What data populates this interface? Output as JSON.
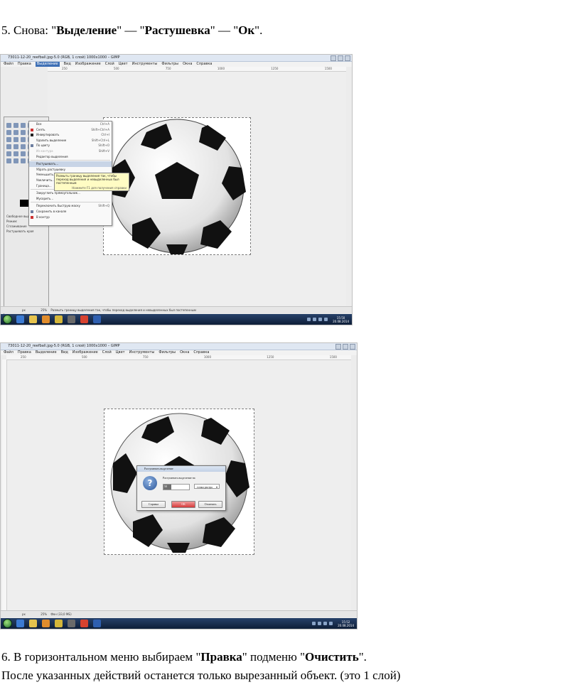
{
  "step5": {
    "prefix": "5. Снова: \"",
    "w1": "Выделение",
    "sep1": "\" — \"",
    "w2": "Растушевка",
    "sep2": "\" — \"",
    "w3": "Ок",
    "suffix": "\"."
  },
  "shot1": {
    "window_title": "73011-12-20_reefball.jpg-5.0 (RGB, 1 слой) 1000x1000 – GIMP",
    "menu": [
      "Файл",
      "Правка",
      "Выделение",
      "Вид",
      "Изображение",
      "Слой",
      "Цвет",
      "Инструменты",
      "Фильтры",
      "Окна",
      "Справка"
    ],
    "menu_active": "Выделение",
    "ruler_ticks": [
      "250",
      "500",
      "750",
      "1000",
      "1250",
      "1500"
    ],
    "selection_menu": [
      {
        "label": "Все",
        "shortcut": "Ctrl+A"
      },
      {
        "label": "Снять",
        "shortcut": "Shift+Ctrl+A"
      },
      {
        "label": "Инвертировать",
        "shortcut": "Ctrl+I"
      },
      {
        "label": "Удалить выделение",
        "shortcut": "Shift+Ctrl+L"
      },
      {
        "label": "По цвету",
        "shortcut": "Shift+O"
      },
      {
        "label": "Из контура",
        "shortcut": "Shift+V"
      },
      {
        "label": "Редактор выделения",
        "shortcut": ""
      },
      {
        "label": "Растушевать...",
        "shortcut": ""
      },
      {
        "label": "Убрать растушевку",
        "shortcut": ""
      },
      {
        "label": "Уменьшить...",
        "shortcut": ""
      },
      {
        "label": "Увеличить...",
        "shortcut": ""
      },
      {
        "label": "Граница...",
        "shortcut": ""
      },
      {
        "label": "Закруглить прямоугольник...",
        "shortcut": ""
      },
      {
        "label": "Мусорить...",
        "shortcut": ""
      },
      {
        "label": "Переключить быструю маску",
        "shortcut": "Shift+Q"
      },
      {
        "label": "Сохранить в канале",
        "shortcut": ""
      },
      {
        "label": "В контур",
        "shortcut": ""
      }
    ],
    "tooltip": "Размыть границу выделения так, чтобы переход выделения и невыделенных был постепенным",
    "tooltip_hint": "Нажмите F1 для получения справки",
    "toolbox_options": [
      "Свободное выделение",
      "Режим:",
      "Сглаживание",
      "Растушевать края"
    ],
    "status_zoom": "px",
    "status_percent": "25%",
    "status_text": "Размыть границу выделения так, чтобы переход выделения и невыделенных был постепенным",
    "clock_time": "15:50",
    "clock_date": "20.08.2014"
  },
  "shot2": {
    "window_title": "73011-12-20_reefball.jpg-5.0 (RGB, 1 слой) 1000x1000 – GIMP",
    "menu": [
      "Файл",
      "Правка",
      "Выделение",
      "Вид",
      "Изображение",
      "Слой",
      "Цвет",
      "Инструменты",
      "Фильтры",
      "Окна",
      "Справка"
    ],
    "ruler_ticks": [
      "250",
      "500",
      "750",
      "1000",
      "1250",
      "1500"
    ],
    "dialog_title": "Растушевать выделение",
    "dialog_label": "Растушевать выделение на",
    "dialog_value": "50",
    "dialog_unit": "точки растра",
    "btn_help": "Справка",
    "btn_ok": "ОК",
    "btn_cancel": "Отменить",
    "status_zoom": "px",
    "status_percent": "25%",
    "status_text": "Фон (33,0 МБ)",
    "clock_time": "15:52",
    "clock_date": "20.08.2014"
  },
  "step6": {
    "prefix": "6. В горизонтальном меню выбираем \"",
    "w1": "Правка",
    "mid": "\" подменю \"",
    "w2": "Очистить",
    "suffix": "\"."
  },
  "step6b": "После указанных действий останется только вырезанный объект. (это 1 слой)",
  "colors": {
    "gimp_bg": "#ececec",
    "taskbar": "#1b2f52",
    "ok_button": "#d43a3a",
    "tooltip": "#fffcc4"
  }
}
